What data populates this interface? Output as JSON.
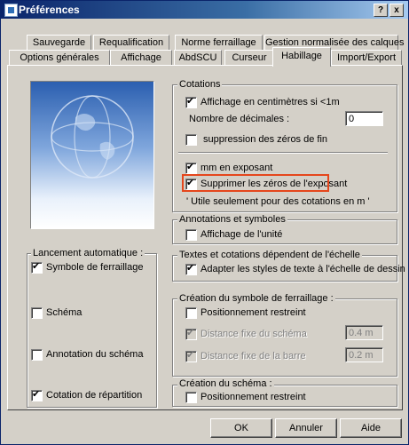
{
  "window": {
    "title": "Préférences",
    "help_label": "?",
    "close_label": "x"
  },
  "tabs_row1": [
    "Sauvegarde",
    "Requalification",
    "Norme ferraillage",
    "Gestion normalisée des calques"
  ],
  "tabs_row2": [
    "Options générales",
    "Affichage",
    "AbdSCU",
    "Curseur",
    "Habillage",
    "Import/Export"
  ],
  "active_tab": "Habillage",
  "left": {
    "group_label": "Lancement automatique :",
    "items": [
      {
        "label": "Symbole de ferraillage",
        "checked": true
      },
      {
        "label": "Schéma",
        "checked": false
      },
      {
        "label": "Annotation du schéma",
        "checked": false
      },
      {
        "label": "Cotation de répartition",
        "checked": true
      }
    ]
  },
  "cotations": {
    "label": "Cotations",
    "cm_label": "Affichage en centimètres si <1m",
    "cm_checked": true,
    "decimals_label": "Nombre de décimales :",
    "decimals_value": "0",
    "trailing_label": "suppression des zéros de fin",
    "trailing_checked": false,
    "exp_label": "mm en exposant",
    "exp_checked": true,
    "zeros_label": "Supprimer les zéros de l'exposant",
    "zeros_checked": true,
    "note": "' Utile seulement pour des cotations en m '"
  },
  "annotations": {
    "label": "Annotations et symboles",
    "unit_label": "Affichage de l'unité",
    "unit_checked": false
  },
  "scale": {
    "label": "Textes et cotations dépendent de l'échelle",
    "adapt_label": "Adapter les styles de texte à l'échelle de dessin",
    "adapt_checked": true
  },
  "symbole": {
    "label": "Création du symbole de ferraillage :",
    "restricted_label": "Positionnement restreint",
    "restricted_checked": false,
    "dist_schema_label": "Distance fixe du schéma",
    "dist_schema_value": "0.4 m",
    "dist_barre_label": "Distance fixe de la barre",
    "dist_barre_value": "0.2 m"
  },
  "schema": {
    "label": "Création du schéma :",
    "restricted_label": "Positionnement restreint",
    "restricted_checked": false
  },
  "buttons": {
    "ok": "OK",
    "cancel": "Annuler",
    "help": "Aide"
  }
}
